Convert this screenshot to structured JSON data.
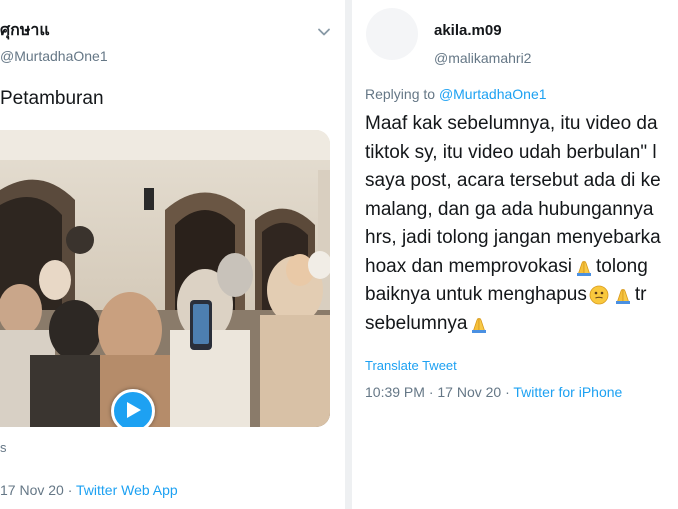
{
  "left_tweet": {
    "display_name": "ศุกษาแ",
    "handle": "@MurtadhaOne1",
    "text": "Petamburan",
    "views": "s",
    "timestamp": "17 Nov 20 · ",
    "source": "Twitter Web App",
    "icons": {
      "menu": "chevron-down-icon",
      "play": "play-icon"
    }
  },
  "right_tweet": {
    "display_name": "akila.m09",
    "handle": "@malikamahri2",
    "replying_prefix": "Replying to ",
    "replying_handle": "@MurtadhaOne1",
    "lines": [
      {
        "text": "Maaf kak sebelumnya, itu video da"
      },
      {
        "text": "tiktok sy, itu video udah berbulan\" l"
      },
      {
        "text": "saya post, acara tersebut ada di ke"
      },
      {
        "text": "malang, dan ga ada hubungannya"
      },
      {
        "text": "hrs, jadi tolong jangan menyebarka"
      },
      {
        "text": "hoax dan memprovokasi",
        "emoji": "folded-hands-icon",
        "after": " tolong"
      },
      {
        "text": "baiknya untuk menghapus",
        "emoji": "face-icon",
        "emoji2": "folded-hands-icon",
        "after": " tr"
      },
      {
        "text": "sebelumnya",
        "emoji": "folded-hands-icon"
      }
    ],
    "translate": "Translate Tweet",
    "timestamp": "10:39 PM · 17 Nov 20 · ",
    "source": "Twitter for iPhone"
  },
  "colors": {
    "link": "#1da1f2",
    "muted": "#657786",
    "text": "#14171a"
  }
}
